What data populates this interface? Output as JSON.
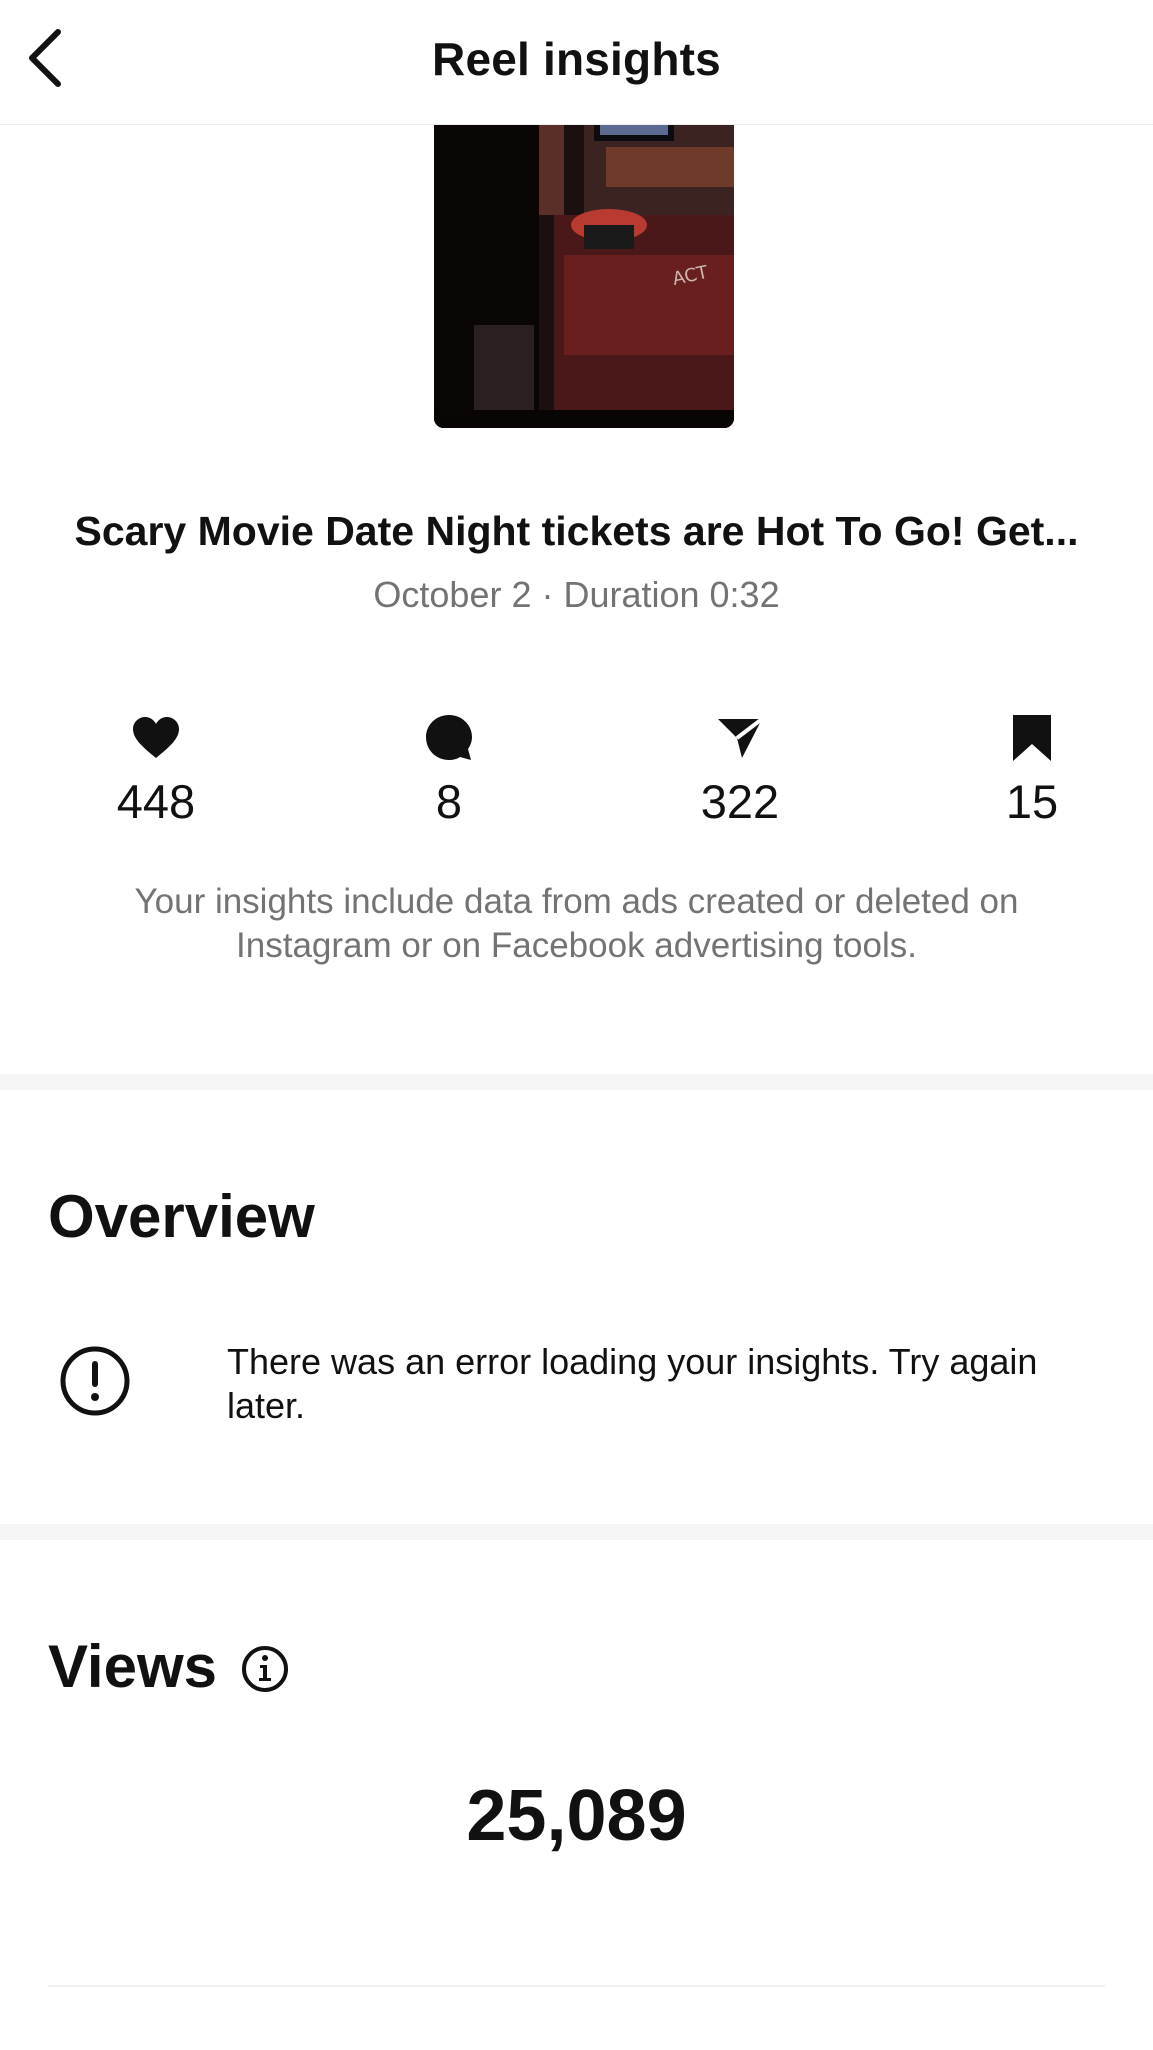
{
  "header": {
    "title": "Reel insights",
    "back_icon": "chevron-left-icon"
  },
  "reel": {
    "title": "Scary Movie Date Night tickets are Hot To Go! Get...",
    "meta": "October 2 · Duration 0:32"
  },
  "stats": {
    "likes": {
      "icon": "heart-icon",
      "value": "448"
    },
    "comments": {
      "icon": "comment-icon",
      "value": "8"
    },
    "shares": {
      "icon": "share-icon",
      "value": "322"
    },
    "saves": {
      "icon": "bookmark-icon",
      "value": "15"
    }
  },
  "disclaimer": "Your insights include data from ads created or deleted on Instagram or on Facebook advertising tools.",
  "overview": {
    "heading": "Overview",
    "error_icon": "alert-circle-icon",
    "error_text": "There was an error loading your insights. Try again later."
  },
  "views": {
    "heading": "Views",
    "info_icon": "info-icon",
    "value": "25,089"
  },
  "colors": {
    "text_primary": "#111111",
    "text_secondary": "#737373",
    "divider": "#f5f5f5"
  }
}
